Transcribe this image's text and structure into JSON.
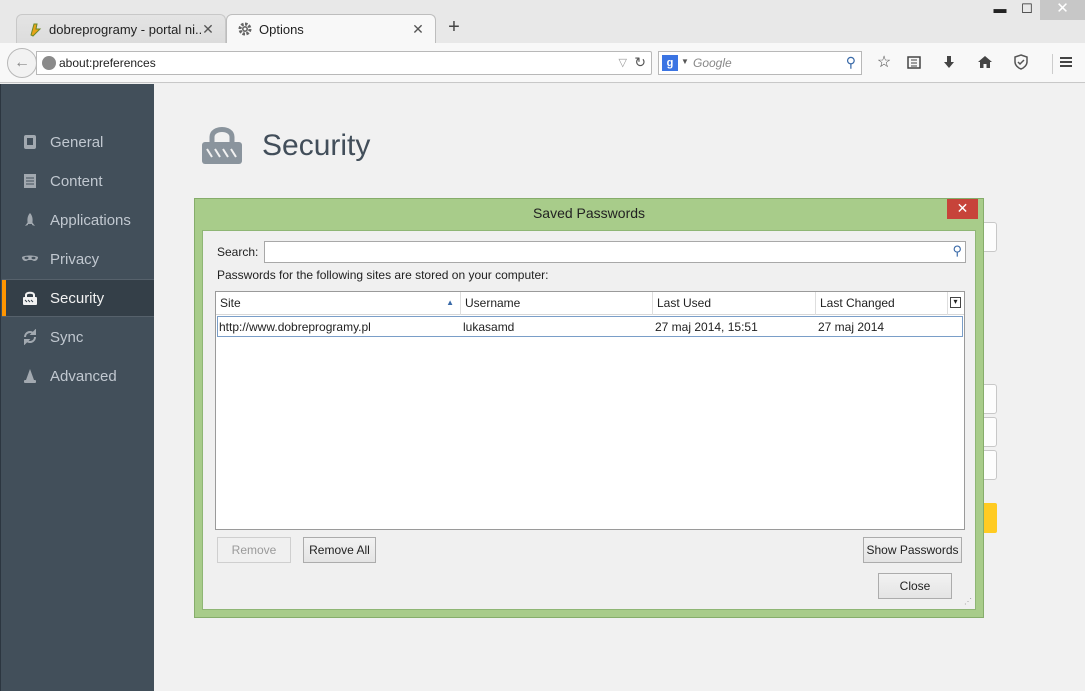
{
  "window": {
    "minimize": "▬",
    "maximize": "☐",
    "close": "✕"
  },
  "tabs": [
    {
      "title": "dobreprogramy - portal ni...",
      "favicon": "dobreprogramy-icon",
      "close": "✕"
    },
    {
      "title": "Options",
      "favicon": "gear-icon",
      "close": "✕"
    }
  ],
  "newtab": "+",
  "navbar": {
    "url": "about:preferences",
    "search_placeholder": "Google",
    "search_engine_letter": "g"
  },
  "sidebar": {
    "items": [
      {
        "label": "General",
        "icon": "general-icon"
      },
      {
        "label": "Content",
        "icon": "content-icon"
      },
      {
        "label": "Applications",
        "icon": "applications-icon"
      },
      {
        "label": "Privacy",
        "icon": "privacy-mask-icon"
      },
      {
        "label": "Security",
        "icon": "lock-icon",
        "active": true
      },
      {
        "label": "Sync",
        "icon": "sync-icon"
      },
      {
        "label": "Advanced",
        "icon": "advanced-wizard-icon"
      }
    ]
  },
  "main": {
    "title": "Security"
  },
  "dialog": {
    "title": "Saved Passwords",
    "search_label": "Search:",
    "info": "Passwords for the following sites are stored on your computer:",
    "columns": [
      "Site",
      "Username",
      "Last Used",
      "Last Changed"
    ],
    "rows": [
      {
        "site": "http://www.dobreprogramy.pl",
        "username": "lukasamd",
        "last_used": "27 maj 2014, 15:51",
        "last_changed": "27 maj 2014"
      }
    ],
    "buttons": {
      "remove": "Remove",
      "remove_all": "Remove All",
      "show_passwords": "Show Passwords",
      "close": "Close"
    }
  },
  "colors": {
    "sidebar_bg": "#424f5a",
    "active_accent": "#ff9500",
    "dialog_frame": "#a8cc8a",
    "dialog_close": "#c7433a"
  }
}
